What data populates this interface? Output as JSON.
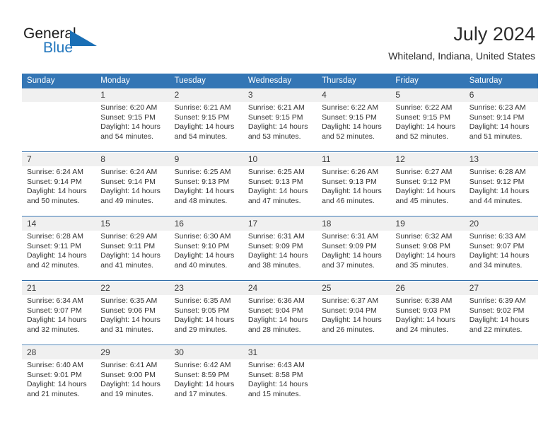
{
  "brand": {
    "name_part1": "General",
    "name_part2": "Blue",
    "triangle_color": "#1a6fb5",
    "text_color": "#1a1a1a",
    "blue_color": "#2176bd"
  },
  "header": {
    "title": "July 2024",
    "subtitle": "Whiteland, Indiana, United States"
  },
  "theme": {
    "header_bg": "#3476b5",
    "daynum_bg": "#f0f0f0",
    "separator": "#2f6ca8"
  },
  "columns": [
    "Sunday",
    "Monday",
    "Tuesday",
    "Wednesday",
    "Thursday",
    "Friday",
    "Saturday"
  ],
  "weeks": [
    [
      {
        "day": "",
        "sunrise": "",
        "sunset": "",
        "daylight_line1": "",
        "daylight_line2": ""
      },
      {
        "day": "1",
        "sunrise": "Sunrise: 6:20 AM",
        "sunset": "Sunset: 9:15 PM",
        "daylight_line1": "Daylight: 14 hours",
        "daylight_line2": "and 54 minutes."
      },
      {
        "day": "2",
        "sunrise": "Sunrise: 6:21 AM",
        "sunset": "Sunset: 9:15 PM",
        "daylight_line1": "Daylight: 14 hours",
        "daylight_line2": "and 54 minutes."
      },
      {
        "day": "3",
        "sunrise": "Sunrise: 6:21 AM",
        "sunset": "Sunset: 9:15 PM",
        "daylight_line1": "Daylight: 14 hours",
        "daylight_line2": "and 53 minutes."
      },
      {
        "day": "4",
        "sunrise": "Sunrise: 6:22 AM",
        "sunset": "Sunset: 9:15 PM",
        "daylight_line1": "Daylight: 14 hours",
        "daylight_line2": "and 52 minutes."
      },
      {
        "day": "5",
        "sunrise": "Sunrise: 6:22 AM",
        "sunset": "Sunset: 9:15 PM",
        "daylight_line1": "Daylight: 14 hours",
        "daylight_line2": "and 52 minutes."
      },
      {
        "day": "6",
        "sunrise": "Sunrise: 6:23 AM",
        "sunset": "Sunset: 9:14 PM",
        "daylight_line1": "Daylight: 14 hours",
        "daylight_line2": "and 51 minutes."
      }
    ],
    [
      {
        "day": "7",
        "sunrise": "Sunrise: 6:24 AM",
        "sunset": "Sunset: 9:14 PM",
        "daylight_line1": "Daylight: 14 hours",
        "daylight_line2": "and 50 minutes."
      },
      {
        "day": "8",
        "sunrise": "Sunrise: 6:24 AM",
        "sunset": "Sunset: 9:14 PM",
        "daylight_line1": "Daylight: 14 hours",
        "daylight_line2": "and 49 minutes."
      },
      {
        "day": "9",
        "sunrise": "Sunrise: 6:25 AM",
        "sunset": "Sunset: 9:13 PM",
        "daylight_line1": "Daylight: 14 hours",
        "daylight_line2": "and 48 minutes."
      },
      {
        "day": "10",
        "sunrise": "Sunrise: 6:25 AM",
        "sunset": "Sunset: 9:13 PM",
        "daylight_line1": "Daylight: 14 hours",
        "daylight_line2": "and 47 minutes."
      },
      {
        "day": "11",
        "sunrise": "Sunrise: 6:26 AM",
        "sunset": "Sunset: 9:13 PM",
        "daylight_line1": "Daylight: 14 hours",
        "daylight_line2": "and 46 minutes."
      },
      {
        "day": "12",
        "sunrise": "Sunrise: 6:27 AM",
        "sunset": "Sunset: 9:12 PM",
        "daylight_line1": "Daylight: 14 hours",
        "daylight_line2": "and 45 minutes."
      },
      {
        "day": "13",
        "sunrise": "Sunrise: 6:28 AM",
        "sunset": "Sunset: 9:12 PM",
        "daylight_line1": "Daylight: 14 hours",
        "daylight_line2": "and 44 minutes."
      }
    ],
    [
      {
        "day": "14",
        "sunrise": "Sunrise: 6:28 AM",
        "sunset": "Sunset: 9:11 PM",
        "daylight_line1": "Daylight: 14 hours",
        "daylight_line2": "and 42 minutes."
      },
      {
        "day": "15",
        "sunrise": "Sunrise: 6:29 AM",
        "sunset": "Sunset: 9:11 PM",
        "daylight_line1": "Daylight: 14 hours",
        "daylight_line2": "and 41 minutes."
      },
      {
        "day": "16",
        "sunrise": "Sunrise: 6:30 AM",
        "sunset": "Sunset: 9:10 PM",
        "daylight_line1": "Daylight: 14 hours",
        "daylight_line2": "and 40 minutes."
      },
      {
        "day": "17",
        "sunrise": "Sunrise: 6:31 AM",
        "sunset": "Sunset: 9:09 PM",
        "daylight_line1": "Daylight: 14 hours",
        "daylight_line2": "and 38 minutes."
      },
      {
        "day": "18",
        "sunrise": "Sunrise: 6:31 AM",
        "sunset": "Sunset: 9:09 PM",
        "daylight_line1": "Daylight: 14 hours",
        "daylight_line2": "and 37 minutes."
      },
      {
        "day": "19",
        "sunrise": "Sunrise: 6:32 AM",
        "sunset": "Sunset: 9:08 PM",
        "daylight_line1": "Daylight: 14 hours",
        "daylight_line2": "and 35 minutes."
      },
      {
        "day": "20",
        "sunrise": "Sunrise: 6:33 AM",
        "sunset": "Sunset: 9:07 PM",
        "daylight_line1": "Daylight: 14 hours",
        "daylight_line2": "and 34 minutes."
      }
    ],
    [
      {
        "day": "21",
        "sunrise": "Sunrise: 6:34 AM",
        "sunset": "Sunset: 9:07 PM",
        "daylight_line1": "Daylight: 14 hours",
        "daylight_line2": "and 32 minutes."
      },
      {
        "day": "22",
        "sunrise": "Sunrise: 6:35 AM",
        "sunset": "Sunset: 9:06 PM",
        "daylight_line1": "Daylight: 14 hours",
        "daylight_line2": "and 31 minutes."
      },
      {
        "day": "23",
        "sunrise": "Sunrise: 6:35 AM",
        "sunset": "Sunset: 9:05 PM",
        "daylight_line1": "Daylight: 14 hours",
        "daylight_line2": "and 29 minutes."
      },
      {
        "day": "24",
        "sunrise": "Sunrise: 6:36 AM",
        "sunset": "Sunset: 9:04 PM",
        "daylight_line1": "Daylight: 14 hours",
        "daylight_line2": "and 28 minutes."
      },
      {
        "day": "25",
        "sunrise": "Sunrise: 6:37 AM",
        "sunset": "Sunset: 9:04 PM",
        "daylight_line1": "Daylight: 14 hours",
        "daylight_line2": "and 26 minutes."
      },
      {
        "day": "26",
        "sunrise": "Sunrise: 6:38 AM",
        "sunset": "Sunset: 9:03 PM",
        "daylight_line1": "Daylight: 14 hours",
        "daylight_line2": "and 24 minutes."
      },
      {
        "day": "27",
        "sunrise": "Sunrise: 6:39 AM",
        "sunset": "Sunset: 9:02 PM",
        "daylight_line1": "Daylight: 14 hours",
        "daylight_line2": "and 22 minutes."
      }
    ],
    [
      {
        "day": "28",
        "sunrise": "Sunrise: 6:40 AM",
        "sunset": "Sunset: 9:01 PM",
        "daylight_line1": "Daylight: 14 hours",
        "daylight_line2": "and 21 minutes."
      },
      {
        "day": "29",
        "sunrise": "Sunrise: 6:41 AM",
        "sunset": "Sunset: 9:00 PM",
        "daylight_line1": "Daylight: 14 hours",
        "daylight_line2": "and 19 minutes."
      },
      {
        "day": "30",
        "sunrise": "Sunrise: 6:42 AM",
        "sunset": "Sunset: 8:59 PM",
        "daylight_line1": "Daylight: 14 hours",
        "daylight_line2": "and 17 minutes."
      },
      {
        "day": "31",
        "sunrise": "Sunrise: 6:43 AM",
        "sunset": "Sunset: 8:58 PM",
        "daylight_line1": "Daylight: 14 hours",
        "daylight_line2": "and 15 minutes."
      },
      {
        "day": "",
        "sunrise": "",
        "sunset": "",
        "daylight_line1": "",
        "daylight_line2": ""
      },
      {
        "day": "",
        "sunrise": "",
        "sunset": "",
        "daylight_line1": "",
        "daylight_line2": ""
      },
      {
        "day": "",
        "sunrise": "",
        "sunset": "",
        "daylight_line1": "",
        "daylight_line2": ""
      }
    ]
  ]
}
